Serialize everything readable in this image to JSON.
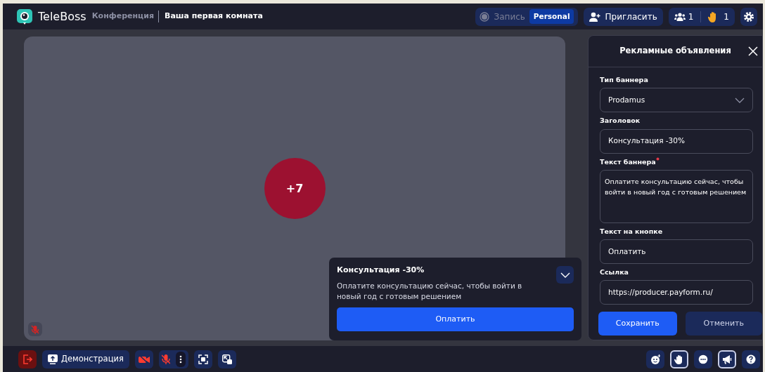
{
  "header": {
    "app_name": "TeleBoss",
    "section": "Конференция",
    "room_title": "Ваша первая комната",
    "record": {
      "label": "Запись",
      "plan": "Personal",
      "recording": false
    },
    "invite": "Пригласить",
    "participants": "1",
    "raised_hands": "1"
  },
  "stage": {
    "avatar_label": "+7",
    "muted": true
  },
  "banner_preview": {
    "title": "Консультация -30%",
    "text": "Оплатите консультацию сейчас, чтобы войти в новый год с готовым решением",
    "button": "Оплатить",
    "expanded": true
  },
  "panel": {
    "title": "Рекламные объявления",
    "fields": [
      {
        "kind": "select",
        "label": "Тип баннера",
        "value": "Prodamus",
        "required": false
      },
      {
        "kind": "input",
        "label": "Заголовок",
        "value": "Консультация -30%",
        "required": false
      },
      {
        "kind": "textarea",
        "label": "Текст баннера",
        "value": "Оплатите консультацию сейчас, чтобы войти в новый год с готовым решением",
        "required": true
      },
      {
        "kind": "input",
        "label": "Текст на кнопке",
        "value": "Оплатить",
        "required": false
      },
      {
        "kind": "input",
        "label": "Ссылка",
        "value": "https://producer.payform.ru/",
        "required": false
      }
    ],
    "save": "Сохранить",
    "cancel": "Отменить"
  },
  "toolbar": {
    "screen_share": "Демонстрация",
    "camera_on": false,
    "mic_on": false,
    "right_tools": [
      {
        "kind": "reaction",
        "active": false
      },
      {
        "kind": "hand",
        "active": true
      },
      {
        "kind": "chat",
        "active": false
      },
      {
        "kind": "ads",
        "active": true
      },
      {
        "kind": "help",
        "active": false
      }
    ]
  }
}
